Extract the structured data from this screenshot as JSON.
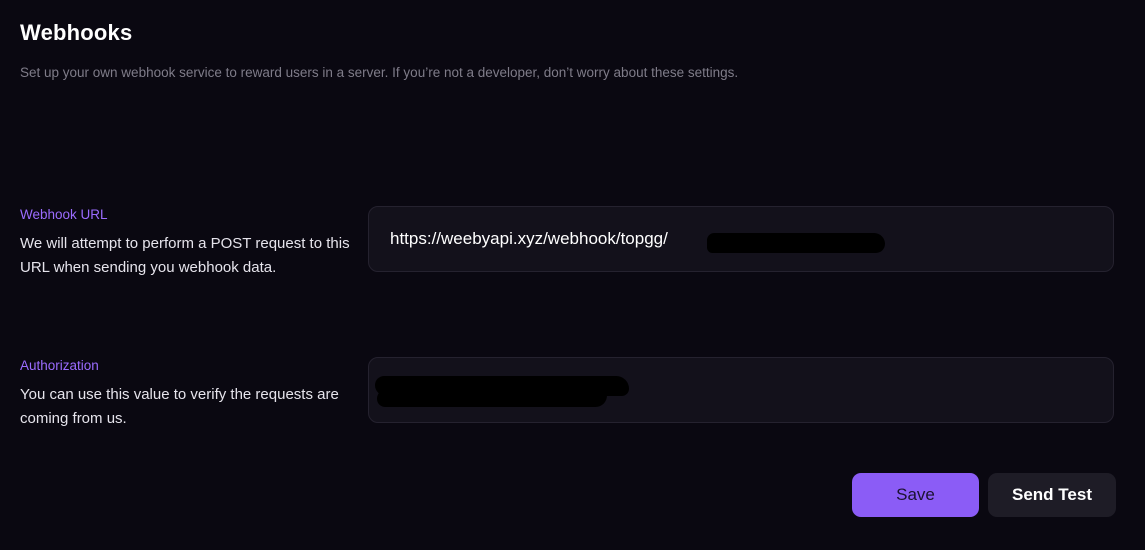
{
  "header": {
    "title": "Webhooks",
    "subtitle": "Set up your own webhook service to reward users in a server. If you’re not a developer, don’t worry about these settings."
  },
  "webhook_url": {
    "label": "Webhook URL",
    "description": "We will attempt to perform a POST request to this URL when sending you webhook data.",
    "value": "https://weebyapi.xyz/webhook/topgg/"
  },
  "authorization": {
    "label": "Authorization",
    "description": "You can use this value to verify the requests are coming from us.",
    "value": ""
  },
  "actions": {
    "save_label": "Save",
    "send_test_label": "Send Test"
  },
  "colors": {
    "background": "#0a0811",
    "accent": "#8b5cf6",
    "label": "#9b6cff",
    "field_bg": "#13111b",
    "secondary_button": "#1e1c26"
  }
}
